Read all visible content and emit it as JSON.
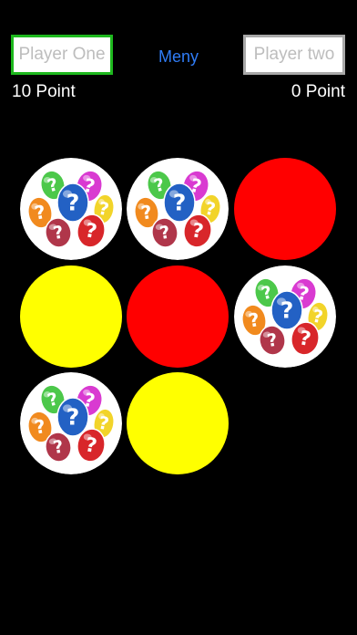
{
  "header": {
    "player_one_placeholder": "Player One",
    "player_two_placeholder": "Player two",
    "menu_label": "Meny",
    "player_one_score": "10 Point",
    "player_two_score": "0 Point"
  },
  "colors": {
    "background": "#000000",
    "player_one_border": "#1db81d",
    "player_two_border": "#a8a8a8",
    "menu_link": "#2f7cf6",
    "red_tile": "#ff0000",
    "yellow_tile": "#ffff00"
  },
  "board": {
    "columns": 3,
    "tiles": [
      {
        "state": "hidden"
      },
      {
        "state": "hidden"
      },
      {
        "state": "red"
      },
      {
        "state": "yellow"
      },
      {
        "state": "red"
      },
      {
        "state": "hidden"
      },
      {
        "state": "hidden"
      },
      {
        "state": "yellow"
      }
    ],
    "hidden_icon": "question-mark-eggs-icon"
  }
}
